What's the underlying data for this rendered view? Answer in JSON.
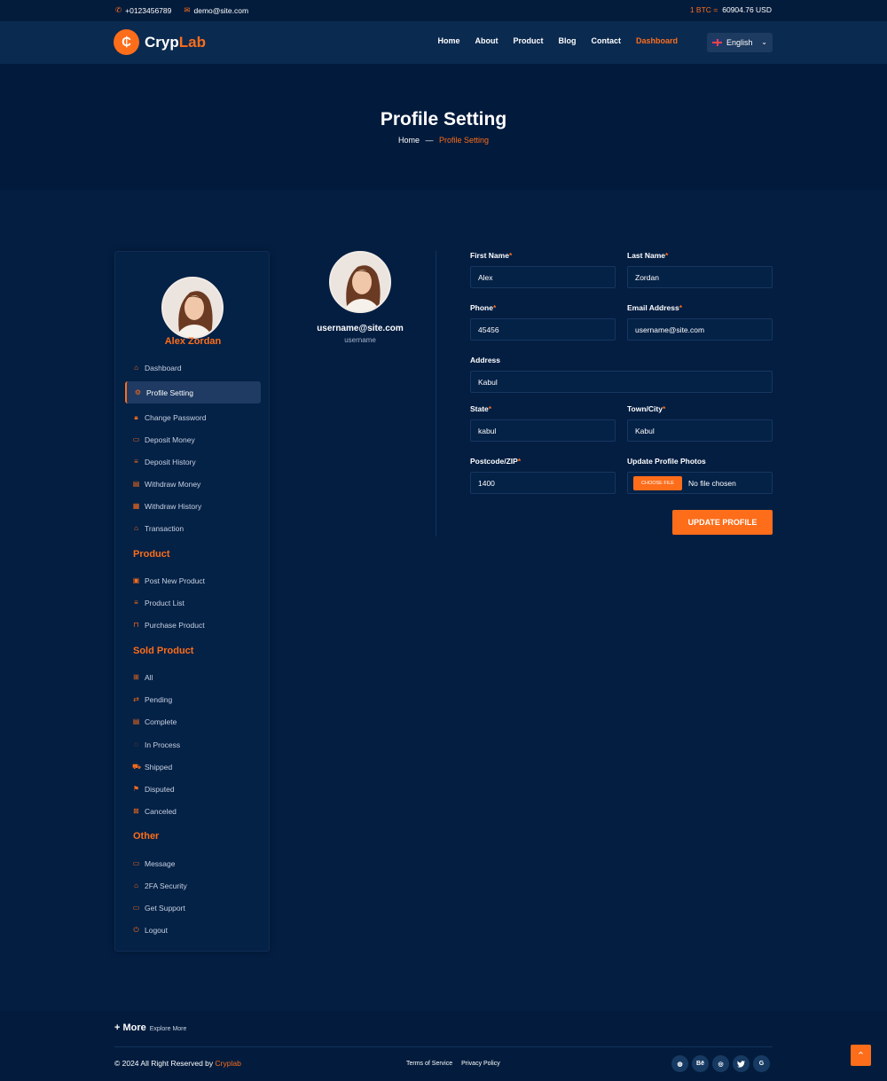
{
  "topbar": {
    "phone": "+0123456789",
    "email": "demo@site.com",
    "btc_label": "1 BTC =",
    "btc_value": "60904.76 USD"
  },
  "header": {
    "logo_part1": "Cryp",
    "logo_part2": "Lab",
    "nav": [
      "Home",
      "About",
      "Product",
      "Blog",
      "Contact",
      "Dashboard"
    ],
    "language": "English"
  },
  "hero": {
    "title": "Profile Setting",
    "breadcrumb_home": "Home",
    "breadcrumb_sep": "—",
    "breadcrumb_current": "Profile Setting"
  },
  "sidebar": {
    "name": "Alex Zordan",
    "main_items": [
      {
        "label": "Dashboard",
        "icon": "home-icon"
      },
      {
        "label": "Profile Setting",
        "icon": "gear-icon"
      },
      {
        "label": "Change Password",
        "icon": "lock-icon"
      },
      {
        "label": "Deposit Money",
        "icon": "wallet-icon"
      },
      {
        "label": "Deposit History",
        "icon": "list-icon"
      },
      {
        "label": "Withdraw Money",
        "icon": "card-icon"
      },
      {
        "label": "Withdraw History",
        "icon": "document-icon"
      },
      {
        "label": "Transaction",
        "icon": "home-icon"
      }
    ],
    "product_heading": "Product",
    "product_items": [
      {
        "label": "Post New Product",
        "icon": "post-icon"
      },
      {
        "label": "Product List",
        "icon": "list-icon"
      },
      {
        "label": "Purchase Product",
        "icon": "bag-icon"
      }
    ],
    "sold_heading": "Sold Product",
    "sold_items": [
      {
        "label": "All",
        "icon": "grid-icon"
      },
      {
        "label": "Pending",
        "icon": "exchange-icon"
      },
      {
        "label": "Complete",
        "icon": "check-table-icon"
      },
      {
        "label": "In Process",
        "icon": "spinner-icon"
      },
      {
        "label": "Shipped",
        "icon": "truck-icon"
      },
      {
        "label": "Disputed",
        "icon": "flag-icon"
      },
      {
        "label": "Canceled",
        "icon": "cancel-icon"
      }
    ],
    "other_heading": "Other",
    "other_items": [
      {
        "label": "Message",
        "icon": "message-icon"
      },
      {
        "label": "2FA Security",
        "icon": "shield-icon"
      },
      {
        "label": "Get Support",
        "icon": "support-icon"
      },
      {
        "label": "Logout",
        "icon": "logout-icon"
      }
    ]
  },
  "profile_card": {
    "email": "username@site.com",
    "username": "username"
  },
  "form": {
    "first_name_label": "First Name",
    "first_name": "Alex",
    "last_name_label": "Last Name",
    "last_name": "Zordan",
    "phone_label": "Phone",
    "phone": "45456",
    "email_label": "Email Address",
    "email": "username@site.com",
    "address_label": "Address",
    "address": "Kabul",
    "state_label": "State",
    "state": "kabul",
    "town_label": "Town/City",
    "town": "Kabul",
    "postcode_label": "Postcode/ZIP",
    "postcode": "1400",
    "photo_label": "Update Profile Photos",
    "choose_file": "CHOOSE FILE",
    "no_file": "No file chosen",
    "required_mark": "*",
    "submit": "UPDATE PROFILE"
  },
  "footer": {
    "more_title": "+ More",
    "more_sub": "Explore More",
    "copyright_prefix": "© 2024 All Right Reserved by",
    "copyright_brand": "Cryplab",
    "links": [
      "Terms of Service",
      "Privacy Policy"
    ],
    "socials": [
      "dribbble-icon",
      "behance-icon",
      "instagram-icon",
      "twitter-icon",
      "google-icon"
    ],
    "social_glyphs": [
      "◍",
      "Bē",
      "◎",
      "🐦",
      "G"
    ]
  },
  "colors": {
    "accent": "#fd6d1a",
    "background": "#041e42"
  }
}
